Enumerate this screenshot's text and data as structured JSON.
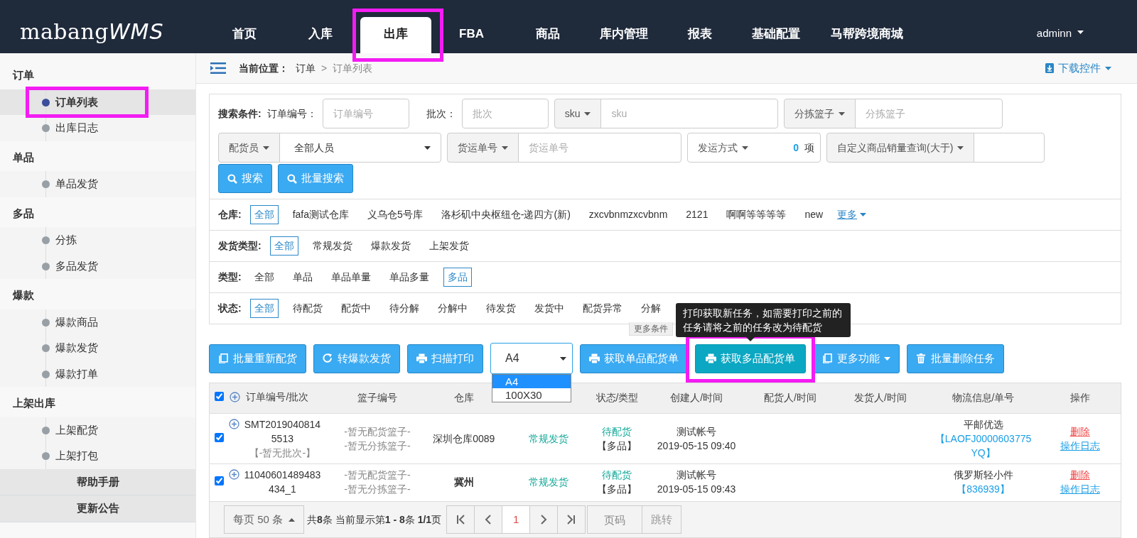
{
  "header": {
    "logo": "mabang",
    "logo_suffix": "WMS",
    "nav": [
      {
        "label": "首页",
        "selected": false,
        "highlighted": false
      },
      {
        "label": "入库",
        "selected": false,
        "highlighted": false
      },
      {
        "label": "出库",
        "selected": true,
        "highlighted": true
      },
      {
        "label": "FBA",
        "selected": false,
        "highlighted": false
      },
      {
        "label": "商品",
        "selected": false,
        "highlighted": false
      },
      {
        "label": "库内管理",
        "selected": false,
        "highlighted": false
      },
      {
        "label": "报表",
        "selected": false,
        "highlighted": false
      },
      {
        "label": "基础配置",
        "selected": false,
        "highlighted": false
      },
      {
        "label": "马帮跨境商城",
        "selected": false,
        "highlighted": false
      }
    ],
    "user": "adminn"
  },
  "sidebar": {
    "groups": [
      {
        "title": "订单",
        "items": [
          {
            "label": "订单列表",
            "selected": true,
            "highlighted": true
          },
          {
            "label": "出库日志",
            "selected": false,
            "highlighted": false
          }
        ]
      },
      {
        "title": "单品",
        "items": [
          {
            "label": "单品发货",
            "selected": false,
            "highlighted": false
          }
        ]
      },
      {
        "title": "多品",
        "items": [
          {
            "label": "分拣",
            "selected": false,
            "highlighted": false
          },
          {
            "label": "多品发货",
            "selected": false,
            "highlighted": false
          }
        ]
      },
      {
        "title": "爆款",
        "items": [
          {
            "label": "爆款商品",
            "selected": false,
            "highlighted": false
          },
          {
            "label": "爆款发货",
            "selected": false,
            "highlighted": false
          },
          {
            "label": "爆款打单",
            "selected": false,
            "highlighted": false
          }
        ]
      },
      {
        "title": "上架出库",
        "items": [
          {
            "label": "上架配货",
            "selected": false,
            "highlighted": false
          },
          {
            "label": "上架打包",
            "selected": false,
            "highlighted": false
          }
        ]
      }
    ],
    "links": [
      "帮助手册",
      "更新公告"
    ]
  },
  "breadcrumb": {
    "label": "当前位置：",
    "items": [
      "订单",
      "订单列表"
    ],
    "separator": ">",
    "download": "下载控件"
  },
  "search": {
    "title": "搜索条件:",
    "rows": [
      [
        {
          "kind": "labeled",
          "label": "订单编号：",
          "placeholder": "订单编号"
        },
        {
          "kind": "labeled",
          "label": "批次：",
          "placeholder": "批次"
        },
        {
          "kind": "addon",
          "label": "sku",
          "placeholder": "sku"
        },
        {
          "kind": "addon",
          "label": "分拣篮子",
          "placeholder": "分拣篮子"
        }
      ],
      [
        {
          "kind": "select",
          "label": "配货员",
          "value": "全部人员"
        },
        {
          "kind": "addon",
          "label": "货运单号",
          "placeholder": "货运单号"
        },
        {
          "kind": "count",
          "label": "发运方式",
          "count": "0",
          "unit": "项"
        },
        {
          "kind": "addon",
          "label": "自定义商品销量查询(大于)"
        }
      ]
    ],
    "buttons": [
      "搜索",
      "批量搜索"
    ]
  },
  "filters": [
    {
      "label": "仓库:",
      "options": [
        {
          "label": "全部",
          "selected": true
        },
        {
          "label": "fafa测试仓库",
          "selected": false
        },
        {
          "label": "义乌仓5号库",
          "selected": false
        },
        {
          "label": "洛杉矶中央枢纽仓-递四方(新)",
          "selected": false
        },
        {
          "label": "zxcvbnmzxcvbnm",
          "selected": false
        },
        {
          "label": "2121",
          "selected": false
        },
        {
          "label": "啊啊等等等等",
          "selected": false
        },
        {
          "label": "new",
          "selected": false
        }
      ],
      "more": "更多"
    },
    {
      "label": "发货类型:",
      "options": [
        {
          "label": "全部",
          "selected": true
        },
        {
          "label": "常规发货",
          "selected": false
        },
        {
          "label": "爆款发货",
          "selected": false
        },
        {
          "label": "上架发货",
          "selected": false
        }
      ]
    },
    {
      "label": "类型:",
      "options": [
        {
          "label": "全部",
          "selected": false
        },
        {
          "label": "单品",
          "selected": false
        },
        {
          "label": "单品单量",
          "selected": false
        },
        {
          "label": "单品多量",
          "selected": false
        },
        {
          "label": "多品",
          "selected": true
        }
      ]
    },
    {
      "label": "状态:",
      "options": [
        {
          "label": "全部",
          "selected": true
        },
        {
          "label": "待配货",
          "selected": false
        },
        {
          "label": "配货中",
          "selected": false
        },
        {
          "label": "待分解",
          "selected": false
        },
        {
          "label": "分解中",
          "selected": false
        },
        {
          "label": "待发货",
          "selected": false
        },
        {
          "label": "发货中",
          "selected": false
        },
        {
          "label": "配货异常",
          "selected": false
        },
        {
          "label": "分解",
          "selected": false
        }
      ]
    }
  ],
  "more_conditions": "更多条件",
  "tooltip": "打印获取新任务，如需要打印之前的任务请将之前的任务改为待配货",
  "toolbar": [
    {
      "kind": "button",
      "label": "批量重新配货",
      "highlighted": false
    },
    {
      "kind": "button",
      "label": "转爆款发货",
      "highlighted": false
    },
    {
      "kind": "button",
      "label": "扫描打印",
      "highlighted": false
    },
    {
      "kind": "select",
      "value": "A4",
      "options": [
        {
          "label": "A4",
          "selected": true
        },
        {
          "label": "100X30",
          "selected": false
        }
      ]
    },
    {
      "kind": "button",
      "label": "获取单品配货单",
      "highlighted": false
    },
    {
      "kind": "accent",
      "label": "获取多品配货单",
      "highlighted": true
    },
    {
      "kind": "dropdown",
      "label": "更多功能",
      "highlighted": false
    },
    {
      "kind": "button",
      "label": "批量删除任务",
      "highlighted": false
    }
  ],
  "table": {
    "all_checked": true,
    "columns": [
      "订单编号/批次",
      "篮子编号",
      "仓库",
      "状态/类型",
      "创建人/时间",
      "配货人/时间",
      "发货人/时间",
      "物流信息/单号",
      "操作"
    ],
    "rows": [
      {
        "checked": true,
        "order_no": "SMT20190408145513",
        "batch": "【-暂无批次-】",
        "baskets": [
          "-暂无配货篮子-",
          "-暂无分拣篮子-"
        ],
        "warehouse": "深圳仓库0089",
        "ship_type": "常规发货",
        "status": "待配货",
        "type": "【多品】",
        "creator": "测试帐号",
        "created": "2019-05-15 09:40",
        "logistics": "平邮优选",
        "tracking": "【LAOFJ0000603775YQ】",
        "actions": [
          "删除",
          "操作日志"
        ]
      },
      {
        "checked": true,
        "order_no": "11040601489483434_1",
        "baskets": [
          "-暂无配货篮子-",
          "-暂无分拣篮子-"
        ],
        "warehouse": "冀州",
        "ship_type": "常规发货",
        "status": "待配货",
        "type": "【多品】",
        "creator": "测试帐号",
        "created": "2019-05-15 09:43",
        "logistics": "俄罗斯轻小件",
        "tracking": "【836939】",
        "actions": [
          "删除",
          "操作日志"
        ]
      }
    ]
  },
  "pagination": {
    "page_size": "每页 50 条",
    "summary": "共**8**条 当前显示第**1 - 8**条 **1/1**页",
    "pages": [
      {
        "label": "1",
        "selected": true
      }
    ],
    "page_placeholder": "页码",
    "go": "跳转"
  }
}
